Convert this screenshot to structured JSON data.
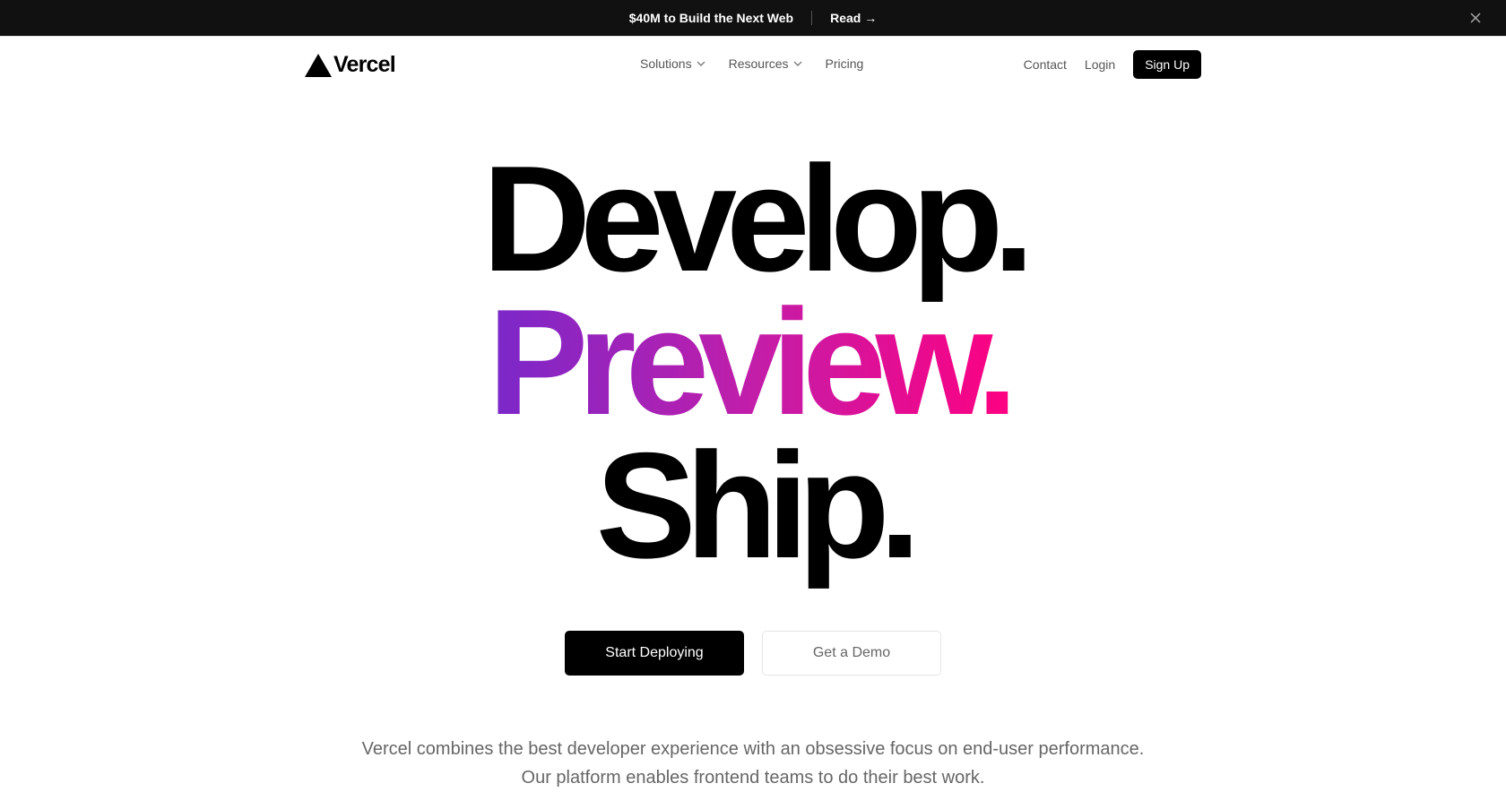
{
  "banner": {
    "message": "$40M to Build the Next Web",
    "link_label": "Read →",
    "close_icon": "close-icon"
  },
  "nav": {
    "logo_text": "Vercel",
    "logo_icon": "triangle-logo-icon",
    "items": [
      {
        "label": "Solutions",
        "has_dropdown": true
      },
      {
        "label": "Resources",
        "has_dropdown": true
      },
      {
        "label": "Pricing",
        "has_dropdown": false
      }
    ],
    "contact_label": "Contact",
    "login_label": "Login",
    "signup_label": "Sign Up"
  },
  "hero": {
    "line1": "Develop.",
    "line2": "Preview.",
    "line3": "Ship.",
    "gradient": [
      "#7928ca",
      "#ff0080"
    ]
  },
  "cta": {
    "primary_label": "Start Deploying",
    "secondary_label": "Get a Demo"
  },
  "description": {
    "line1": "Vercel combines the best developer experience with an obsessive focus on end-user performance.",
    "line2": "Our platform enables frontend teams to do their best work."
  },
  "colors": {
    "banner_bg": "#111111",
    "text_muted": "#666666",
    "primary": "#000000"
  }
}
